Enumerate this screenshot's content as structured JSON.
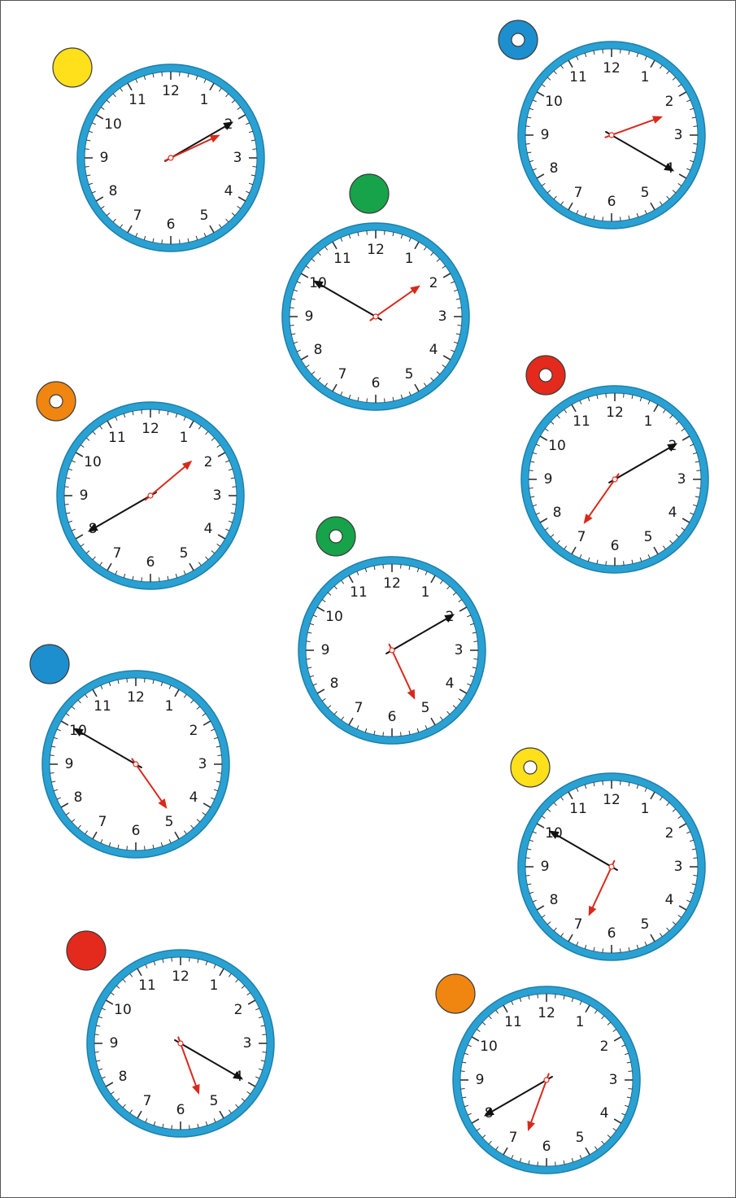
{
  "numerals": [
    "12",
    "1",
    "2",
    "3",
    "4",
    "5",
    "6",
    "7",
    "8",
    "9",
    "10",
    "11"
  ],
  "colors": {
    "rim": "#2aa1d3",
    "rim_edge": "#1f7fa8",
    "face": "#ffffff",
    "ticks": "#333333",
    "minute_hand": "#111111",
    "hour_hand": "#d9291c"
  },
  "clocks": [
    {
      "id": "clock-1",
      "marker": {
        "color": "#ffe01a",
        "style": "filled"
      },
      "time": {
        "hour": 2,
        "minute": 10
      }
    },
    {
      "id": "clock-2",
      "marker": {
        "color": "#1d8fcf",
        "style": "ring"
      },
      "time": {
        "hour": 2,
        "minute": 20
      }
    },
    {
      "id": "clock-3",
      "marker": {
        "color": "#17a34a",
        "style": "filled"
      },
      "time": {
        "hour": 1,
        "minute": 50
      }
    },
    {
      "id": "clock-4",
      "marker": {
        "color": "#f0860f",
        "style": "ring"
      },
      "time": {
        "hour": 1,
        "minute": 40
      }
    },
    {
      "id": "clock-5",
      "marker": {
        "color": "#e32a1d",
        "style": "ring"
      },
      "time": {
        "hour": 7,
        "minute": 10
      }
    },
    {
      "id": "clock-6",
      "marker": {
        "color": "#17a34a",
        "style": "ring"
      },
      "time": {
        "hour": 5,
        "minute": 10
      }
    },
    {
      "id": "clock-7",
      "marker": {
        "color": "#1d8fcf",
        "style": "filled"
      },
      "time": {
        "hour": 4,
        "minute": 50
      }
    },
    {
      "id": "clock-8",
      "marker": {
        "color": "#ffe01a",
        "style": "ring"
      },
      "time": {
        "hour": 6,
        "minute": 50
      }
    },
    {
      "id": "clock-9",
      "marker": {
        "color": "#e32a1d",
        "style": "filled"
      },
      "time": {
        "hour": 5,
        "minute": 20
      }
    },
    {
      "id": "clock-10",
      "marker": {
        "color": "#f0860f",
        "style": "filled"
      },
      "time": {
        "hour": 6,
        "minute": 40
      }
    }
  ]
}
